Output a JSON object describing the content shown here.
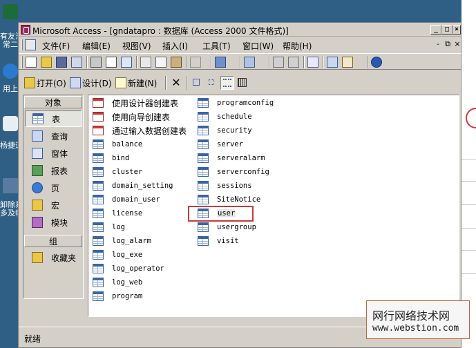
{
  "desktop": {
    "icons": [
      {
        "name": "desktop-icon-1",
        "label": "有友浩"
      },
      {
        "name": "desktop-icon-2",
        "label": "常二"
      },
      {
        "name": "desktop-icon-3",
        "label": "用上"
      },
      {
        "name": "desktop-icon-4",
        "label": "杨捷道"
      },
      {
        "name": "desktop-icon-5",
        "label": "卸除易"
      },
      {
        "name": "desktop-icon-6",
        "label": "多及帧"
      }
    ]
  },
  "window": {
    "title": "Microsoft Access - [gndatapro : 数据库 (Access 2000 文件格式)]",
    "min_btn": "_",
    "max_btn": "□",
    "close_btn": "×"
  },
  "menubar": {
    "items": [
      {
        "key": "file",
        "label": "文件(F)"
      },
      {
        "key": "edit",
        "label": "编辑(E)"
      },
      {
        "key": "view",
        "label": "视图(V)"
      },
      {
        "key": "insert",
        "label": "插入(I)"
      },
      {
        "key": "tools",
        "label": "工具(T)"
      },
      {
        "key": "window",
        "label": "窗口(W)"
      },
      {
        "key": "help",
        "label": "帮助(H)"
      }
    ],
    "mdi_min": "-",
    "mdi_restore": "⧉",
    "mdi_close": "×"
  },
  "db_toolbar": {
    "open_label": "打开(O)",
    "design_label": "设计(D)",
    "new_label": "新建(N)"
  },
  "objects_bar": {
    "objects_header": "对象",
    "groups_header": "组",
    "items": [
      {
        "key": "tables",
        "label": "表",
        "selected": true
      },
      {
        "key": "queries",
        "label": "查询"
      },
      {
        "key": "forms",
        "label": "窗体"
      },
      {
        "key": "reports",
        "label": "报表"
      },
      {
        "key": "pages",
        "label": "页"
      },
      {
        "key": "macros",
        "label": "宏"
      },
      {
        "key": "modules",
        "label": "模块"
      }
    ],
    "favorites_label": "收藏夹"
  },
  "tables": {
    "column1": [
      {
        "label": "使用设计器创建表",
        "kind": "wizard"
      },
      {
        "label": "使用向导创建表",
        "kind": "wizard"
      },
      {
        "label": "通过输入数据创建表",
        "kind": "wizard"
      },
      {
        "label": "balance",
        "kind": "table"
      },
      {
        "label": "bind",
        "kind": "table"
      },
      {
        "label": "cluster",
        "kind": "table"
      },
      {
        "label": "domain_setting",
        "kind": "table"
      },
      {
        "label": "domain_user",
        "kind": "table"
      },
      {
        "label": "license",
        "kind": "table"
      },
      {
        "label": "log",
        "kind": "table"
      },
      {
        "label": "log_alarm",
        "kind": "table"
      },
      {
        "label": "log_exe",
        "kind": "table"
      },
      {
        "label": "log_operator",
        "kind": "table"
      },
      {
        "label": "log_web",
        "kind": "table"
      },
      {
        "label": "program",
        "kind": "table"
      }
    ],
    "column2": [
      {
        "label": "programconfig",
        "kind": "table"
      },
      {
        "label": "schedule",
        "kind": "table"
      },
      {
        "label": "security",
        "kind": "table"
      },
      {
        "label": "server",
        "kind": "table"
      },
      {
        "label": "serveralarm",
        "kind": "table"
      },
      {
        "label": "serverconfig",
        "kind": "table"
      },
      {
        "label": "sessions",
        "kind": "table"
      },
      {
        "label": "SiteNotice",
        "kind": "table"
      },
      {
        "label": "user",
        "kind": "table",
        "highlighted": true
      },
      {
        "label": "usergroup",
        "kind": "table"
      },
      {
        "label": "visit",
        "kind": "table"
      }
    ]
  },
  "statusbar": {
    "text": "就绪"
  },
  "watermark": {
    "line1": "网行网络技术网",
    "line2": "www.webstion.com"
  }
}
